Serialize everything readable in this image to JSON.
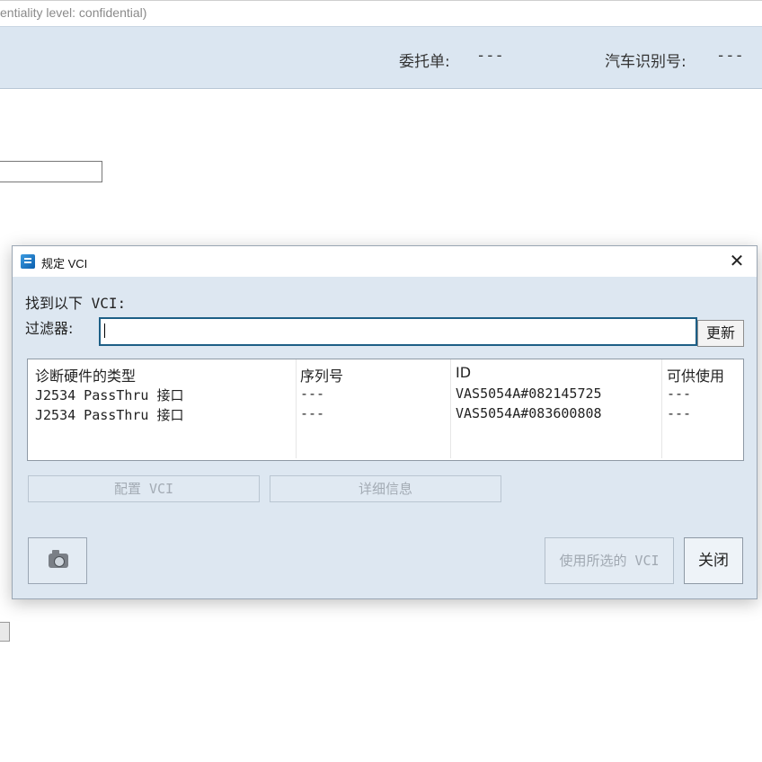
{
  "page": {
    "confidentiality_text": "entiality level: confidential)",
    "header": {
      "order_label": "委托单:",
      "order_value": "---",
      "vin_label": "汽车识别号:",
      "vin_value": "---"
    }
  },
  "dialog": {
    "title": "规定 VCI",
    "close_glyph": "✕",
    "found_label": "找到以下 VCI:",
    "filter_label": "过滤器:",
    "filter_value": "",
    "refresh_label": "更新",
    "table": {
      "columns": [
        "诊断硬件的类型",
        "序列号",
        "ID",
        "可供使用"
      ],
      "rows": [
        [
          "J2534 PassThru 接口",
          "---",
          "VAS5054A#082145725",
          "---"
        ],
        [
          "J2534 PassThru 接口",
          "---",
          "VAS5054A#083600808",
          "---"
        ]
      ]
    },
    "configure_label": "配置 VCI",
    "details_label": "详细信息",
    "camera_icon": "camera-icon",
    "use_selected_label": "使用所选的 VCI",
    "close_label": "关闭"
  },
  "colors": {
    "header_band": "#dbe6f1",
    "dialog_bg": "#dde7f1",
    "filter_border": "#1d5f86"
  }
}
